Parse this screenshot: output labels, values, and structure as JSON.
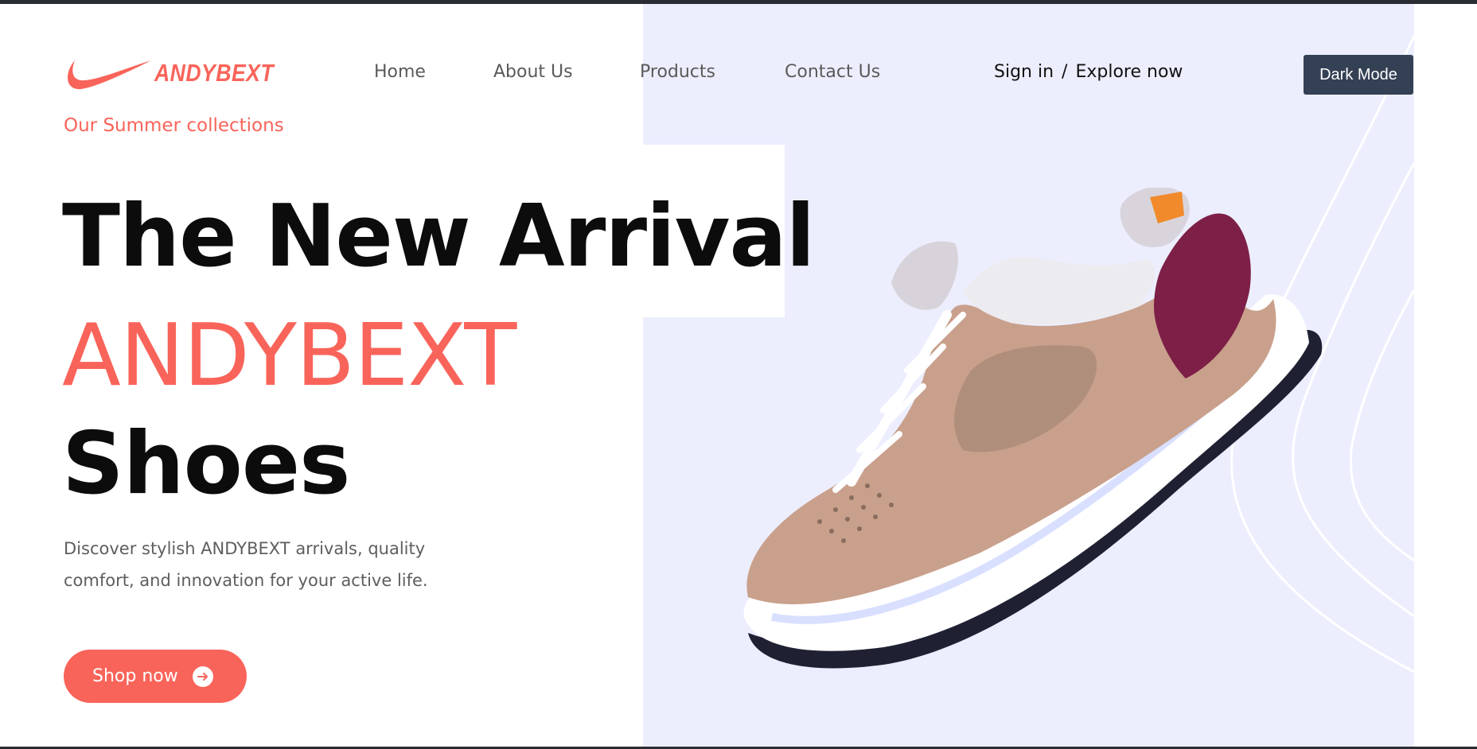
{
  "brand": {
    "name": "ANDYBEXT",
    "logo_icon": "swoosh-icon",
    "accent_color": "#f9645a"
  },
  "nav": {
    "items": [
      {
        "label": "Home"
      },
      {
        "label": "About Us"
      },
      {
        "label": "Products"
      },
      {
        "label": "Contact Us"
      }
    ]
  },
  "auth": {
    "sign_in": "Sign in",
    "separator": "/",
    "explore": "Explore now"
  },
  "theme_toggle": {
    "label": "Dark Mode",
    "color": "#344054"
  },
  "hero": {
    "eyebrow": "Our Summer collections",
    "title_line1": "The New Arrival",
    "title_line2": "ANDYBEXT",
    "title_line3": "Shoes",
    "description": "Discover stylish ANDYBEXT arrivals, quality comfort, and innovation for your active life.",
    "cta_label": "Shop now",
    "cta_icon": "arrow-right-circle-icon",
    "panel_color": "#eceefe"
  }
}
